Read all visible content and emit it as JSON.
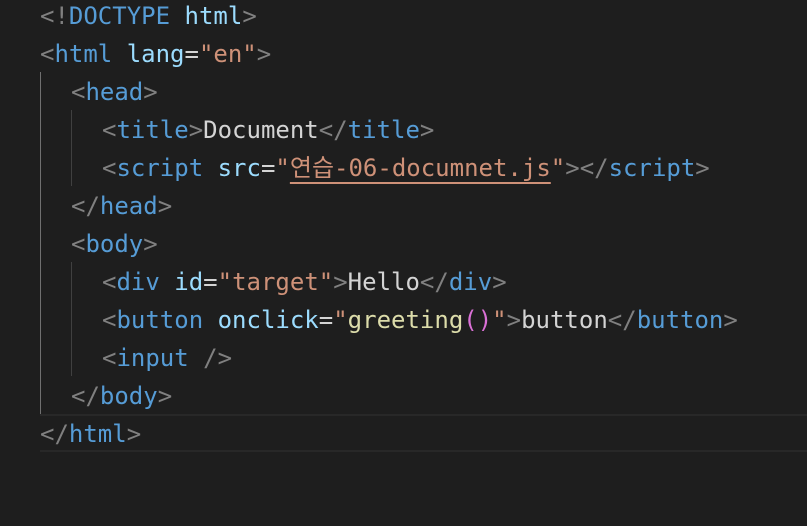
{
  "code": {
    "line1": {
      "open": "<!",
      "doctype": "DOCTYPE",
      "name": "html",
      "close": ">"
    },
    "line2": {
      "open": "<",
      "tag": "html",
      "attr": "lang",
      "eq": "=",
      "value": "\"en\"",
      "close": ">"
    },
    "line3": {
      "open": "<",
      "tag": "head",
      "close": ">"
    },
    "line4": {
      "open": "<",
      "tag": "title",
      "close": ">",
      "text": "Document",
      "end_open": "</",
      "end_tag": "title",
      "end_close": ">"
    },
    "line5": {
      "open": "<",
      "tag": "script",
      "attr": "src",
      "eq": "=",
      "quote_open": "\"",
      "value": "연습-06-documnet.js",
      "quote_close": "\"",
      "close": ">",
      "end_open": "</",
      "end_tag": "script",
      "end_close": ">"
    },
    "line6": {
      "open": "</",
      "tag": "head",
      "close": ">"
    },
    "line7": {
      "open": "<",
      "tag": "body",
      "close": ">"
    },
    "line8": {
      "open": "<",
      "tag": "div",
      "attr": "id",
      "eq": "=",
      "value": "\"target\"",
      "close": ">",
      "text": "Hello",
      "end_open": "</",
      "end_tag": "div",
      "end_close": ">"
    },
    "line9": {
      "open": "<",
      "tag": "button",
      "attr": "onclick",
      "eq": "=",
      "quote_open": "\"",
      "fn": "greeting",
      "parens": "()",
      "quote_close": "\"",
      "close": ">",
      "text": "button",
      "end_open": "</",
      "end_tag": "button",
      "end_close": ">"
    },
    "line10": {
      "open": "<",
      "tag": "input",
      "self_close": "/>"
    },
    "line11": {
      "open": "</",
      "tag": "body",
      "close": ">"
    },
    "line12": {
      "open": "</",
      "tag": "html",
      "close": ">"
    }
  },
  "colors": {
    "background": "#1e1e1e",
    "tag": "#569cd6",
    "attribute": "#9cdcfe",
    "string": "#ce9178",
    "bracket": "#808080",
    "text": "#d4d4d4",
    "function": "#dcdcaa"
  }
}
